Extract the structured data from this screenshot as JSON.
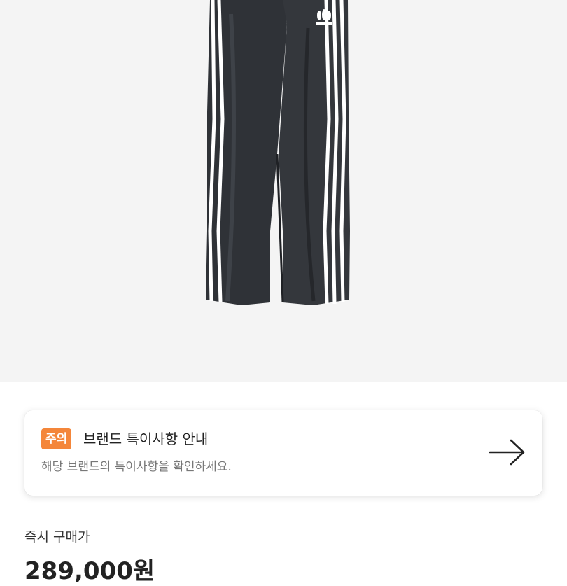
{
  "product": {
    "image_alt": "black wide-leg track pants with three white stripes",
    "logo_text": "adidas"
  },
  "notice": {
    "badge": "주의",
    "title": "브랜드 특이사항 안내",
    "description": "해당 브랜드의 특이사항을 확인하세요.",
    "action_icon": "arrow-right-icon"
  },
  "price": {
    "label": "즉시 구매가",
    "value": "289,000원"
  },
  "colors": {
    "badge": "#f4863a",
    "hero_bg": "#f4f4f4"
  }
}
